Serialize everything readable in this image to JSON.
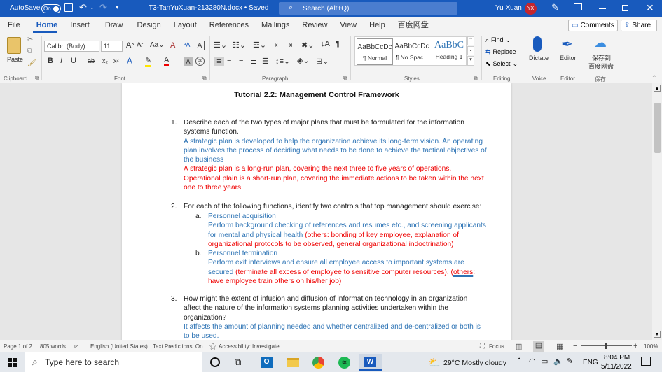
{
  "titlebar": {
    "autosave_label": "AutoSave",
    "autosave_state": "On",
    "doc_title": "T3-TanYuXuan-213280N.docx • Saved",
    "search_placeholder": "Search (Alt+Q)",
    "user_name": "Yu Xuan",
    "user_initials": "YX"
  },
  "tabs": [
    "File",
    "Home",
    "Insert",
    "Draw",
    "Design",
    "Layout",
    "References",
    "Mailings",
    "Review",
    "View",
    "Help",
    "百度网盘"
  ],
  "active_tab": "Home",
  "tab_actions": {
    "comments": "Comments",
    "share": "Share"
  },
  "ribbon": {
    "paste": "Paste",
    "font_name": "Calibri (Body)",
    "font_size": "11",
    "styles": [
      {
        "preview": "AaBbCcDc",
        "name": "¶ Normal"
      },
      {
        "preview": "AaBbCcDc",
        "name": "¶ No Spac..."
      },
      {
        "preview": "AaBbC",
        "name": "Heading 1"
      }
    ],
    "find": "Find",
    "replace": "Replace",
    "select": "Select",
    "dictate": "Dictate",
    "editor": "Editor",
    "baidu_save_1": "保存到",
    "baidu_save_2": "百度网盘",
    "groups": {
      "clipboard": "Clipboard",
      "font": "Font",
      "paragraph": "Paragraph",
      "styles": "Styles",
      "editing": "Editing",
      "voice": "Voice",
      "editor": "Editor",
      "save": "保存"
    }
  },
  "doc": {
    "title": "Tutorial 2.2:  Management Control Framework",
    "q1_num": "1.",
    "q1_l1": "Describe each of the two types of major plans that must be formulated for the information",
    "q1_l2": "systems function.",
    "q1_b1": "A strategic plan is developed to help the organization achieve its long-term vision. An operating",
    "q1_b2": "plan involves the process of deciding what needs to be done to achieve the tactical objectives of",
    "q1_b3": "the business",
    "q1_r1": "A strategic plan is a long-run plan, covering the next three to five years of operations.",
    "q1_r2": "Operational plain is a short-run plan, covering the immediate actions to be taken within the next",
    "q1_r3": "one to three years.",
    "q2_num": "2.",
    "q2_l1": "For each of the following functions, identify two controls that top management should exercise:",
    "q2a_letter": "a.",
    "q2a_title": "Personnel acquisition",
    "q2a_b1": "Perform background checking of references and resumes etc., and screening applicants",
    "q2a_b2": "for mental and physical health",
    "q2a_r2": " (others: bonding of key employee, explanation of",
    "q2a_r3": "organizational protocols to be observed, general organizational indoctrination)",
    "q2b_letter": "b.",
    "q2b_title": "Personnel termination",
    "q2b_b1": "Perform exit interviews and ensure all employee access to important systems are",
    "q2b_b2": "secured",
    "q2b_r2a": " (terminate all excess of employee to sensitive computer resources). (",
    "q2b_r2b": "others",
    "q2b_r2c": ":",
    "q2b_r3": "have employee train others on his/her job)",
    "q3_num": "3.",
    "q3_l1": "How might the extent of infusion and diffusion of information technology in an organization",
    "q3_l2": "affect the nature of the information systems planning activities undertaken within the",
    "q3_l3": "organization?",
    "q3_b1": "It affects the amount of planning needed and whether centralized and de-centralized or both is",
    "q3_b2": "to be used."
  },
  "status": {
    "page": "Page 1 of 2",
    "words": "805 words",
    "language": "English (United States)",
    "predictions": "Text Predictions: On",
    "accessibility": "Accessibility: Investigate",
    "focus": "Focus",
    "zoom": "100%"
  },
  "taskbar": {
    "search_placeholder": "Type here to search",
    "weather": "29°C  Mostly cloudy",
    "lang": "ENG",
    "time": "8:04 PM",
    "date": "5/11/2022"
  },
  "colors": {
    "accent": "#185abd",
    "blue_text": "#2e74b5",
    "red_text": "#ee0000"
  }
}
